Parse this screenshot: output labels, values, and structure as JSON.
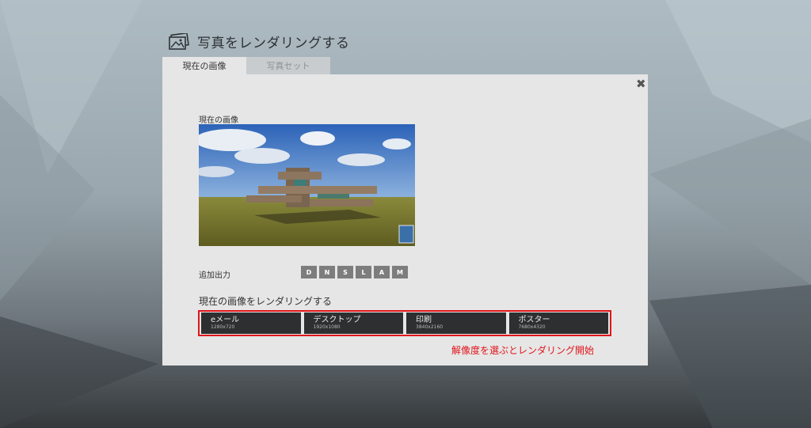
{
  "window": {
    "title": "写真をレンダリングする"
  },
  "tabs": [
    {
      "label": "現在の画像",
      "active": true
    },
    {
      "label": "写真セット",
      "active": false
    }
  ],
  "preview": {
    "label": "現在の画像"
  },
  "additional_output": {
    "label": "追加出力",
    "buttons": [
      "D",
      "N",
      "S",
      "L",
      "A",
      "M"
    ]
  },
  "render": {
    "heading": "現在の画像をレンダリングする",
    "options": [
      {
        "name": "eメール",
        "size": "1280x720"
      },
      {
        "name": "デスクトップ",
        "size": "1920x1080"
      },
      {
        "name": "印刷",
        "size": "3840x2160"
      },
      {
        "name": "ポスター",
        "size": "7680x4320"
      }
    ]
  },
  "annotation": "解像度を選ぶとレンダリング開始",
  "colors": {
    "accent_red": "#e0151b",
    "panel": "#e6e6e6",
    "button_dark": "#2e2f30"
  }
}
